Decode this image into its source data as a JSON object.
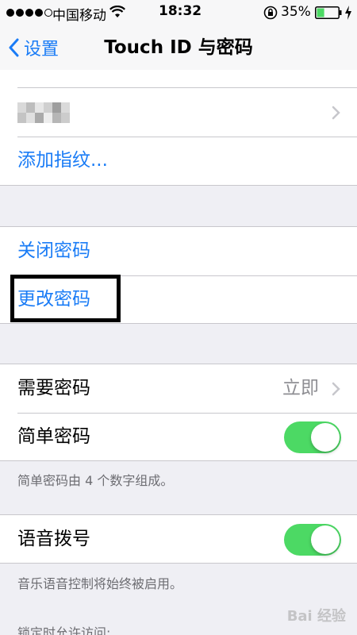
{
  "status_bar": {
    "carrier": "中国移动",
    "time": "18:32",
    "battery_percent": "35%",
    "signal_bars_filled": 4,
    "signal_bars_total": 5,
    "battery_level": 0.35
  },
  "nav": {
    "back_label": "设置",
    "title": "Touch ID 与密码"
  },
  "fingerprint_group": {
    "add_fingerprint_label": "添加指纹..."
  },
  "passcode_group": {
    "turn_off_label": "关闭密码",
    "change_label": "更改密码"
  },
  "require_group": {
    "require_label": "需要密码",
    "require_value": "立即",
    "simple_label": "简单密码",
    "simple_on": true,
    "note": "简单密码由 4 个数字组成。"
  },
  "voice_group": {
    "voice_dial_label": "语音拨号",
    "voice_dial_on": true,
    "note": "音乐语音控制将始终被启用。"
  },
  "allow_when_locked_header": "锁定时允许访问:",
  "watermark": "Bai 经验",
  "colors": {
    "accent": "#1a7cf6",
    "toggle_on": "#4cd964",
    "background": "#efeff4"
  }
}
